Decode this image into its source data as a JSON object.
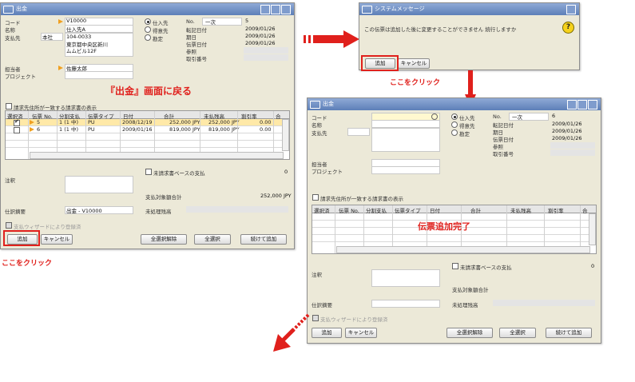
{
  "colors": {
    "accent_red": "#e0201c",
    "title_bar": "#5d7fb8",
    "selected_row": "#ffe9a8",
    "window_bg": "#ece9d8"
  },
  "win1": {
    "title": "出金",
    "labels": {
      "code": "コード",
      "name": "名称",
      "payee": "支払先",
      "contact": "担当者",
      "project": "プロジェクト"
    },
    "values": {
      "code": "V10000",
      "name": "仕入先A",
      "payee_select": "本社",
      "address_lines": [
        "104-0033",
        "東京都中央区新川",
        "ムムビル12F"
      ],
      "contact": "佐藤太郎"
    },
    "radios": [
      "仕入先",
      "得意先",
      "勘定"
    ],
    "right_labels": {
      "no": "No.",
      "doc_date": "転記日付",
      "due_date": "期日",
      "doc_date2": "伝票日付",
      "ref": "参照",
      "trans_no": "取引番号"
    },
    "right_values": {
      "series": "一次",
      "number": "5",
      "doc_date": "2009/01/26",
      "due_date": "2009/01/26",
      "doc_date2": "2009/01/26"
    },
    "show_payments_label": "請求先住所がー致する請求書の表示",
    "grid_headers": [
      "選択済",
      "伝票 No.",
      "分割支払",
      "伝票タイプ",
      "日付",
      "合計",
      "未払残高",
      "割引率",
      "合"
    ],
    "rows": [
      {
        "no": "5",
        "split": "1 (1 中)",
        "type": "PU",
        "date": "2008/12/19",
        "total": "252,000 JPY",
        "balance": "252,000 JPY",
        "rate": "0.00"
      },
      {
        "no": "6",
        "split": "1 (1 中)",
        "type": "PU",
        "date": "2009/01/16",
        "total": "819,000 JPY",
        "balance": "819,000 JPY",
        "rate": "0.00"
      }
    ],
    "footer_labels": {
      "remarks": "注釈",
      "payment_on_account": "未請求書ベースの支払",
      "total_amount": "支払対象額合計",
      "journal_remarks": "仕訳摘要",
      "open_balance": "未処理残高",
      "wizard": "支払ウィザードにより登録済"
    },
    "footer_values": {
      "zero": "0",
      "total_amount": "252,000 JPY",
      "journal_remarks": "出金 - V10000"
    },
    "buttons": {
      "add": "追加",
      "cancel": "キャンセル",
      "deselect_all": "全選択解除",
      "select_all": "全選択",
      "continue_add": "続けて追加"
    }
  },
  "annot": {
    "return_to_payment": "『出金』画面に戻る",
    "click_here_1": "ここをクリック",
    "click_here_2": "ここをクリック",
    "doc_added": "伝票追加完了"
  },
  "msgbox": {
    "title": "システムメッセージ",
    "message": "この伝票は追加した後に変更することができません 続行しますか",
    "buttons": {
      "add": "追加",
      "cancel": "キャンセル"
    }
  },
  "win2": {
    "title": "出金",
    "labels": {
      "code": "コード",
      "name": "名称",
      "payee": "支払先",
      "contact": "担当者",
      "project": "プロジェクト"
    },
    "radios": [
      "仕入先",
      "得意先",
      "勘定"
    ],
    "right_labels": {
      "no": "No.",
      "doc_date": "転記日付",
      "due_date": "期日",
      "doc_date2": "伝票日付",
      "ref": "参照",
      "trans_no": "取引番号"
    },
    "right_values": {
      "series": "一次",
      "number": "6",
      "doc_date": "2009/01/26",
      "due_date": "2009/01/26",
      "doc_date2": "2009/01/26"
    },
    "show_payments_label": "請求先住所が一致する請求書の表示",
    "grid_headers": [
      "選択済",
      "伝票 No.",
      "分割支払",
      "伝票タイプ",
      "日付",
      "合計",
      "未払残高",
      "割引率",
      "合"
    ],
    "footer_labels": {
      "remarks": "注釈",
      "payment_on_account": "未請求書ベースの支払",
      "total_amount": "支払対象額合計",
      "journal_remarks": "仕訳摘要",
      "open_balance": "未処理残高",
      "wizard": "支払ウィザードにより登録済"
    },
    "footer_values": {
      "zero": "0"
    },
    "buttons": {
      "add": "追加",
      "cancel": "キャンセル",
      "deselect_all": "全選択解除",
      "select_all": "全選択",
      "continue_add": "続けて追加"
    }
  }
}
